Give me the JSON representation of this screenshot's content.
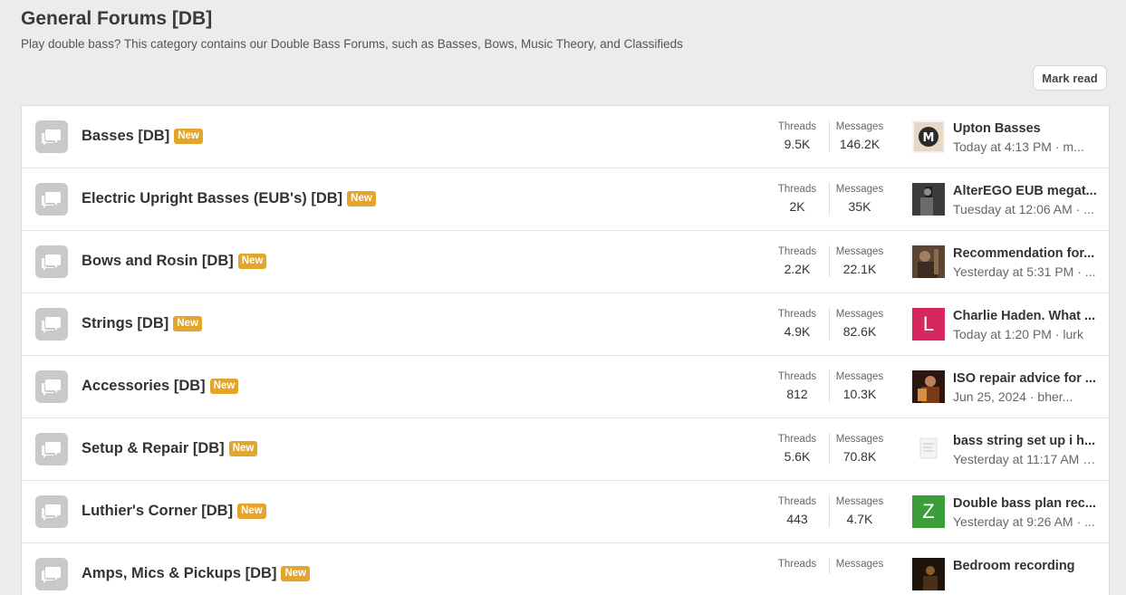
{
  "page": {
    "title": "General Forums [DB]",
    "description": "Play double bass? This category contains our Double Bass Forums, such as Basses, Bows, Music Theory, and Classifieds",
    "mark_read_label": "Mark read"
  },
  "labels": {
    "threads": "Threads",
    "messages": "Messages",
    "new_badge": "New"
  },
  "forums": [
    {
      "title": "Basses [DB]",
      "threads": "9.5K",
      "messages": "146.2K",
      "latest": {
        "title": "Upton Basses",
        "time": "Today at 4:13 PM",
        "user": "m..."
      }
    },
    {
      "title": "Electric Upright Basses (EUB's) [DB]",
      "threads": "2K",
      "messages": "35K",
      "latest": {
        "title": "AlterEGO EUB megat...",
        "time": "Tuesday at 12:06 AM",
        "user": "..."
      }
    },
    {
      "title": "Bows and Rosin [DB]",
      "threads": "2.2K",
      "messages": "22.1K",
      "latest": {
        "title": "Recommendation for...",
        "time": "Yesterday at 5:31 PM",
        "user": "..."
      }
    },
    {
      "title": "Strings [DB]",
      "threads": "4.9K",
      "messages": "82.6K",
      "latest": {
        "title": "Charlie Haden. What ...",
        "time": "Today at 1:20 PM",
        "user": "lurk",
        "avatar_letter": "L",
        "avatar_color": "#d6275e"
      }
    },
    {
      "title": "Accessories [DB]",
      "threads": "812",
      "messages": "10.3K",
      "latest": {
        "title": "ISO repair advice for ...",
        "time": "Jun 25, 2024",
        "user": "bher..."
      }
    },
    {
      "title": "Setup & Repair [DB]",
      "threads": "5.6K",
      "messages": "70.8K",
      "latest": {
        "title": "bass string set up i h...",
        "time": "Yesterday at 11:17 AM",
        "user": "..."
      }
    },
    {
      "title": "Luthier's Corner [DB]",
      "threads": "443",
      "messages": "4.7K",
      "latest": {
        "title": "Double bass plan rec...",
        "time": "Yesterday at 9:26 AM",
        "user": "...",
        "avatar_letter": "Z",
        "avatar_color": "#3b9e3b"
      }
    },
    {
      "title": "Amps, Mics & Pickups [DB]",
      "threads": "",
      "messages": "",
      "latest": {
        "title": "Bedroom recording",
        "time": "",
        "user": ""
      }
    }
  ],
  "colors": {
    "new_badge": "#e3a52b",
    "background": "#ececec"
  }
}
